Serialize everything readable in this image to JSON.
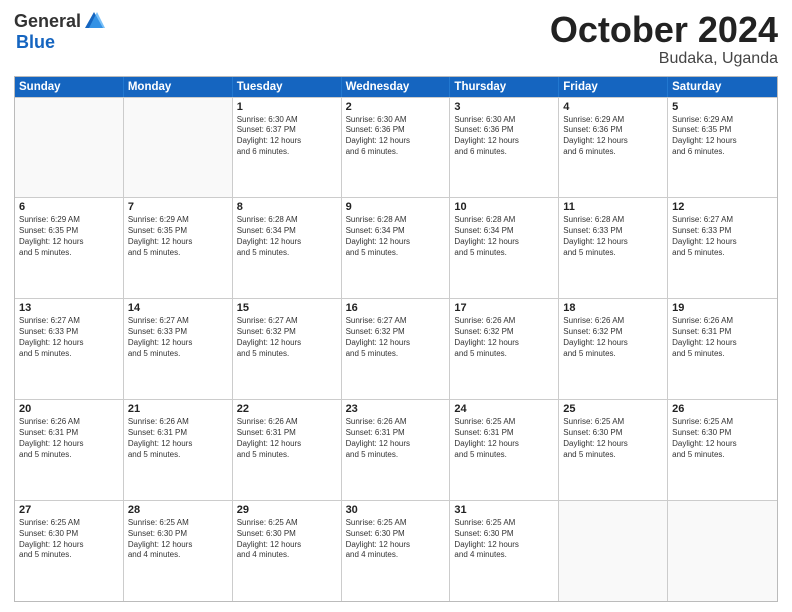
{
  "header": {
    "logo": {
      "general": "General",
      "blue": "Blue"
    },
    "title": "October 2024",
    "location": "Budaka, Uganda"
  },
  "days_of_week": [
    "Sunday",
    "Monday",
    "Tuesday",
    "Wednesday",
    "Thursday",
    "Friday",
    "Saturday"
  ],
  "weeks": [
    [
      {
        "day": "",
        "info": ""
      },
      {
        "day": "",
        "info": ""
      },
      {
        "day": "1",
        "info": "Sunrise: 6:30 AM\nSunset: 6:37 PM\nDaylight: 12 hours\nand 6 minutes."
      },
      {
        "day": "2",
        "info": "Sunrise: 6:30 AM\nSunset: 6:36 PM\nDaylight: 12 hours\nand 6 minutes."
      },
      {
        "day": "3",
        "info": "Sunrise: 6:30 AM\nSunset: 6:36 PM\nDaylight: 12 hours\nand 6 minutes."
      },
      {
        "day": "4",
        "info": "Sunrise: 6:29 AM\nSunset: 6:36 PM\nDaylight: 12 hours\nand 6 minutes."
      },
      {
        "day": "5",
        "info": "Sunrise: 6:29 AM\nSunset: 6:35 PM\nDaylight: 12 hours\nand 6 minutes."
      }
    ],
    [
      {
        "day": "6",
        "info": "Sunrise: 6:29 AM\nSunset: 6:35 PM\nDaylight: 12 hours\nand 5 minutes."
      },
      {
        "day": "7",
        "info": "Sunrise: 6:29 AM\nSunset: 6:35 PM\nDaylight: 12 hours\nand 5 minutes."
      },
      {
        "day": "8",
        "info": "Sunrise: 6:28 AM\nSunset: 6:34 PM\nDaylight: 12 hours\nand 5 minutes."
      },
      {
        "day": "9",
        "info": "Sunrise: 6:28 AM\nSunset: 6:34 PM\nDaylight: 12 hours\nand 5 minutes."
      },
      {
        "day": "10",
        "info": "Sunrise: 6:28 AM\nSunset: 6:34 PM\nDaylight: 12 hours\nand 5 minutes."
      },
      {
        "day": "11",
        "info": "Sunrise: 6:28 AM\nSunset: 6:33 PM\nDaylight: 12 hours\nand 5 minutes."
      },
      {
        "day": "12",
        "info": "Sunrise: 6:27 AM\nSunset: 6:33 PM\nDaylight: 12 hours\nand 5 minutes."
      }
    ],
    [
      {
        "day": "13",
        "info": "Sunrise: 6:27 AM\nSunset: 6:33 PM\nDaylight: 12 hours\nand 5 minutes."
      },
      {
        "day": "14",
        "info": "Sunrise: 6:27 AM\nSunset: 6:33 PM\nDaylight: 12 hours\nand 5 minutes."
      },
      {
        "day": "15",
        "info": "Sunrise: 6:27 AM\nSunset: 6:32 PM\nDaylight: 12 hours\nand 5 minutes."
      },
      {
        "day": "16",
        "info": "Sunrise: 6:27 AM\nSunset: 6:32 PM\nDaylight: 12 hours\nand 5 minutes."
      },
      {
        "day": "17",
        "info": "Sunrise: 6:26 AM\nSunset: 6:32 PM\nDaylight: 12 hours\nand 5 minutes."
      },
      {
        "day": "18",
        "info": "Sunrise: 6:26 AM\nSunset: 6:32 PM\nDaylight: 12 hours\nand 5 minutes."
      },
      {
        "day": "19",
        "info": "Sunrise: 6:26 AM\nSunset: 6:31 PM\nDaylight: 12 hours\nand 5 minutes."
      }
    ],
    [
      {
        "day": "20",
        "info": "Sunrise: 6:26 AM\nSunset: 6:31 PM\nDaylight: 12 hours\nand 5 minutes."
      },
      {
        "day": "21",
        "info": "Sunrise: 6:26 AM\nSunset: 6:31 PM\nDaylight: 12 hours\nand 5 minutes."
      },
      {
        "day": "22",
        "info": "Sunrise: 6:26 AM\nSunset: 6:31 PM\nDaylight: 12 hours\nand 5 minutes."
      },
      {
        "day": "23",
        "info": "Sunrise: 6:26 AM\nSunset: 6:31 PM\nDaylight: 12 hours\nand 5 minutes."
      },
      {
        "day": "24",
        "info": "Sunrise: 6:25 AM\nSunset: 6:31 PM\nDaylight: 12 hours\nand 5 minutes."
      },
      {
        "day": "25",
        "info": "Sunrise: 6:25 AM\nSunset: 6:30 PM\nDaylight: 12 hours\nand 5 minutes."
      },
      {
        "day": "26",
        "info": "Sunrise: 6:25 AM\nSunset: 6:30 PM\nDaylight: 12 hours\nand 5 minutes."
      }
    ],
    [
      {
        "day": "27",
        "info": "Sunrise: 6:25 AM\nSunset: 6:30 PM\nDaylight: 12 hours\nand 5 minutes."
      },
      {
        "day": "28",
        "info": "Sunrise: 6:25 AM\nSunset: 6:30 PM\nDaylight: 12 hours\nand 4 minutes."
      },
      {
        "day": "29",
        "info": "Sunrise: 6:25 AM\nSunset: 6:30 PM\nDaylight: 12 hours\nand 4 minutes."
      },
      {
        "day": "30",
        "info": "Sunrise: 6:25 AM\nSunset: 6:30 PM\nDaylight: 12 hours\nand 4 minutes."
      },
      {
        "day": "31",
        "info": "Sunrise: 6:25 AM\nSunset: 6:30 PM\nDaylight: 12 hours\nand 4 minutes."
      },
      {
        "day": "",
        "info": ""
      },
      {
        "day": "",
        "info": ""
      }
    ]
  ]
}
